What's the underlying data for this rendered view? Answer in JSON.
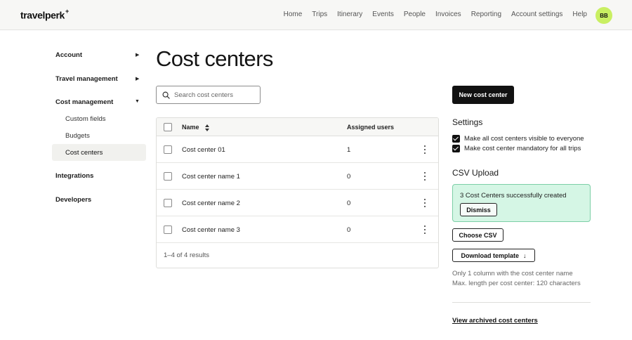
{
  "header": {
    "logo": "travelperk",
    "logo_plus": "+",
    "nav": [
      "Home",
      "Trips",
      "Itinerary",
      "Events",
      "People",
      "Invoices",
      "Reporting",
      "Account settings",
      "Help"
    ],
    "avatar": "BB"
  },
  "sidebar": {
    "account": "Account",
    "travel_management": "Travel management",
    "cost_management": "Cost management",
    "sub_items": [
      "Custom fields",
      "Budgets",
      "Cost centers"
    ],
    "integrations": "Integrations",
    "developers": "Developers"
  },
  "main": {
    "title": "Cost centers",
    "search_placeholder": "Search cost centers",
    "columns": {
      "name": "Name",
      "assigned": "Assigned users"
    },
    "rows": [
      {
        "name": "Cost center 01",
        "users": "1"
      },
      {
        "name": "Cost center name 1",
        "users": "0"
      },
      {
        "name": "Cost center name 2",
        "users": "0"
      },
      {
        "name": "Cost center name 3",
        "users": "0"
      }
    ],
    "footer": "1–4 of 4 results"
  },
  "panel": {
    "new_button": "New cost center",
    "settings_title": "Settings",
    "settings": [
      "Make all cost centers visible to everyone",
      "Make cost center mandatory for all trips"
    ],
    "csv_title": "CSV Upload",
    "success_message": "3 Cost Centers successfully created",
    "dismiss": "Dismiss",
    "choose_csv": "Choose CSV",
    "download_template": "Download template",
    "note1": "Only 1 column with the cost center name",
    "note2": "Max. length per cost center: 120 characters",
    "archived_link": "View archived cost centers"
  }
}
